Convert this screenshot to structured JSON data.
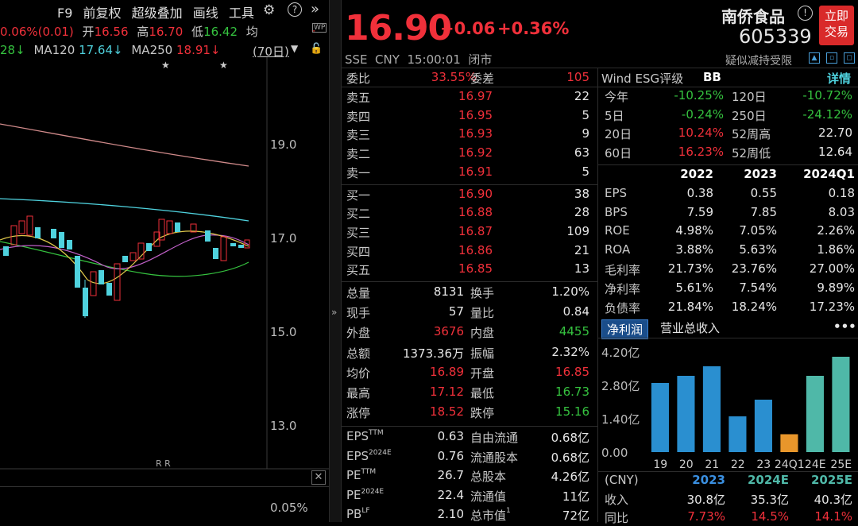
{
  "left_toolbar": {
    "f9": "F9",
    "adjust": "前复权",
    "overlay": "超级叠加",
    "draw": "画线",
    "tools": "工具"
  },
  "quote_line": {
    "change": "0.06%(0.01)",
    "open_label": "开",
    "open": "16.56",
    "high_label": "高",
    "high": "16.70",
    "low_label": "低",
    "low": "16.42",
    "avg_label": "均"
  },
  "ma_line": {
    "ma_prev": "28↓",
    "ma120_label": "MA120",
    "ma120": "17.64↓",
    "ma250_label": "MA250",
    "ma250": "18.91↓",
    "period": "(70日)"
  },
  "price_axis": [
    "19.0",
    "17.0",
    "15.0",
    "13.0"
  ],
  "volume_axis": "0.05%",
  "rr_mark": "R R",
  "header": {
    "price": "16.90",
    "change": "+0.06",
    "change_pct": "+0.36%",
    "name": "南侨食品",
    "code": "605339",
    "exchange_line": "SSE  CNY  15:00:01  闭市",
    "note": "疑似减持受限",
    "trade_btn_1": "立即",
    "trade_btn_2": "交易"
  },
  "order_book": {
    "ratio_label": "委比",
    "ratio": "33.55%",
    "diff_label": "委差",
    "diff": "105",
    "asks": [
      {
        "label": "卖五",
        "price": "16.97",
        "vol": "22"
      },
      {
        "label": "卖四",
        "price": "16.95",
        "vol": "5"
      },
      {
        "label": "卖三",
        "price": "16.93",
        "vol": "9"
      },
      {
        "label": "卖二",
        "price": "16.92",
        "vol": "63"
      },
      {
        "label": "卖一",
        "price": "16.91",
        "vol": "5"
      }
    ],
    "bids": [
      {
        "label": "买一",
        "price": "16.90",
        "vol": "38"
      },
      {
        "label": "买二",
        "price": "16.88",
        "vol": "28"
      },
      {
        "label": "买三",
        "price": "16.87",
        "vol": "109"
      },
      {
        "label": "买四",
        "price": "16.86",
        "vol": "21"
      },
      {
        "label": "买五",
        "price": "16.85",
        "vol": "13"
      }
    ]
  },
  "stats": [
    {
      "l1": "总量",
      "v1": "8131",
      "c1": "white",
      "l2": "换手",
      "v2": "1.20%",
      "c2": "white"
    },
    {
      "l1": "现手",
      "v1": "57",
      "c1": "white",
      "l2": "量比",
      "v2": "0.84",
      "c2": "white"
    },
    {
      "l1": "外盘",
      "v1": "3676",
      "c1": "red",
      "l2": "内盘",
      "v2": "4455",
      "c2": "green"
    },
    {
      "l1": "总额",
      "v1": "1373.36万",
      "c1": "white",
      "l2": "振幅",
      "v2": "2.32%",
      "c2": "white"
    },
    {
      "l1": "均价",
      "v1": "16.89",
      "c1": "red",
      "l2": "开盘",
      "v2": "16.85",
      "c2": "red"
    },
    {
      "l1": "最高",
      "v1": "17.12",
      "c1": "red",
      "l2": "最低",
      "v2": "16.73",
      "c2": "green"
    },
    {
      "l1": "涨停",
      "v1": "18.52",
      "c1": "red",
      "l2": "跌停",
      "v2": "15.16",
      "c2": "green"
    }
  ],
  "valuation": [
    {
      "l1": "EPS",
      "s1": "TTM",
      "v1": "0.63",
      "l2": "自由流通",
      "v2": "0.68亿"
    },
    {
      "l1": "EPS",
      "s1": "2024E",
      "v1": "0.76",
      "l2": "流通股本",
      "v2": "0.68亿"
    },
    {
      "l1": "PE",
      "s1": "TTM",
      "v1": "26.7",
      "l2": "总股本",
      "v2": "4.26亿"
    },
    {
      "l1": "PE",
      "s1": "2024E",
      "v1": "22.4",
      "l2": "流通值",
      "v2": "11亿"
    },
    {
      "l1": "PB",
      "s1": "LF",
      "v1": "2.10",
      "l2": "总市值",
      "s2": "1",
      "v2": "72亿"
    }
  ],
  "esg": {
    "label": "Wind ESG评级",
    "rating": "BB",
    "detail": "详情"
  },
  "perf": [
    {
      "l1": "今年",
      "v1": "-10.25%",
      "c1": "green",
      "l2": "120日",
      "v2": "-10.72%",
      "c2": "green"
    },
    {
      "l1": "5日",
      "v1": "-0.24%",
      "c1": "green",
      "l2": "250日",
      "v2": "-24.12%",
      "c2": "green"
    },
    {
      "l1": "20日",
      "v1": "10.24%",
      "c1": "red",
      "l2": "52周高",
      "v2": "22.70",
      "c2": "white"
    },
    {
      "l1": "60日",
      "v1": "16.23%",
      "c1": "red",
      "l2": "52周低",
      "v2": "12.64",
      "c2": "white"
    }
  ],
  "fin_years": [
    "2022",
    "2023",
    "2024Q1"
  ],
  "fin_rows": [
    {
      "label": "EPS",
      "vals": [
        "0.38",
        "0.55",
        "0.18"
      ]
    },
    {
      "label": "BPS",
      "vals": [
        "7.59",
        "7.85",
        "8.03"
      ]
    },
    {
      "label": "ROE",
      "vals": [
        "4.98%",
        "7.05%",
        "2.26%"
      ]
    },
    {
      "label": "ROA",
      "vals": [
        "3.88%",
        "5.63%",
        "1.86%"
      ]
    },
    {
      "label": "毛利率",
      "vals": [
        "21.73%",
        "23.76%",
        "27.00%"
      ]
    },
    {
      "label": "净利率",
      "vals": [
        "5.61%",
        "7.54%",
        "9.89%"
      ]
    },
    {
      "label": "负债率",
      "vals": [
        "21.84%",
        "18.24%",
        "17.23%"
      ]
    }
  ],
  "fin_tabs": {
    "active": "净利润",
    "other": "营业总收入",
    "more": "•••"
  },
  "chart_data": {
    "type": "bar",
    "categories": [
      "19",
      "20",
      "21",
      "22",
      "23",
      "24Q1",
      "24E",
      "25E"
    ],
    "values": [
      2.9,
      3.2,
      3.6,
      1.5,
      2.2,
      0.75,
      3.2,
      4.0
    ],
    "colors": [
      "#2a8fd0",
      "#2a8fd0",
      "#2a8fd0",
      "#2a8fd0",
      "#2a8fd0",
      "#e8962b",
      "#4fb8a8",
      "#4fb8a8"
    ],
    "y_ticks": [
      "4.20亿",
      "2.80亿",
      "1.40亿",
      "0.00"
    ],
    "ylim": [
      0,
      4.2
    ],
    "tick_labels": [
      "19",
      "20",
      "21",
      "22",
      "23",
      "24Q1",
      "24E",
      "25E"
    ]
  },
  "forecast": {
    "unit": "(CNY)",
    "years": [
      "2023",
      "2024E",
      "2025E"
    ],
    "rows": [
      {
        "label": "收入",
        "vals": [
          "30.8亿",
          "35.3亿",
          "40.3亿"
        ]
      },
      {
        "label": "同比",
        "vals": [
          "7.73%",
          "14.5%",
          "14.1%"
        ]
      }
    ]
  }
}
